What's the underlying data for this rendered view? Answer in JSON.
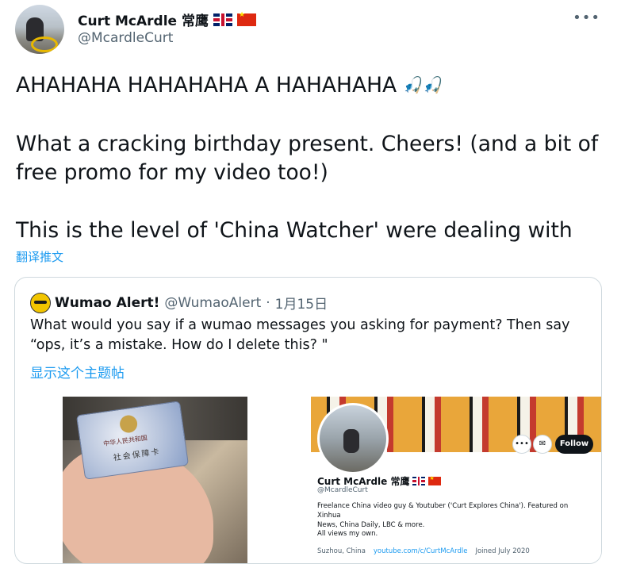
{
  "tweet": {
    "author_name": "Curt McArdle 常鹰",
    "author_handle": "@McardleCurt",
    "lines": [
      "AHAHAHA HAHAHAHA A HAHAHAHA",
      "What a cracking birthday present. Cheers! (and a bit of",
      "free promo for my video too!)",
      "This is the level of 'China Watcher' were dealing with"
    ],
    "emoji": "🎣",
    "translate_label": "翻译推文"
  },
  "quote": {
    "name": "Wumao Alert!",
    "handle": "@WumaoAlert",
    "separator": "·",
    "date": "1月15日",
    "text_line1": "What would you say if a wumao messages you asking for payment? Then say",
    "text_line2": "“ops, it’s a mistake. How do I delete this? \"",
    "show_thread": "显示这个主题帖",
    "card_line1": "中华人民共和国",
    "card_line2": "社会保障卡"
  },
  "profile_shot": {
    "name": "Curt McArdle 常鹰",
    "handle": "@McardleCurt",
    "follow": "Follow",
    "bio_line1": "Freelance China video guy & Youtuber ('Curt Explores China'). Featured on Xinhua",
    "bio_line2": "News, China Daily, LBC & more.",
    "views": "All views my own.",
    "location": "Suzhou, China",
    "link": "youtube.com/c/CurtMcArdle",
    "joined": "Joined July 2020"
  },
  "icons": {
    "more": "•••",
    "more_small": "•••",
    "mail": "✉"
  }
}
